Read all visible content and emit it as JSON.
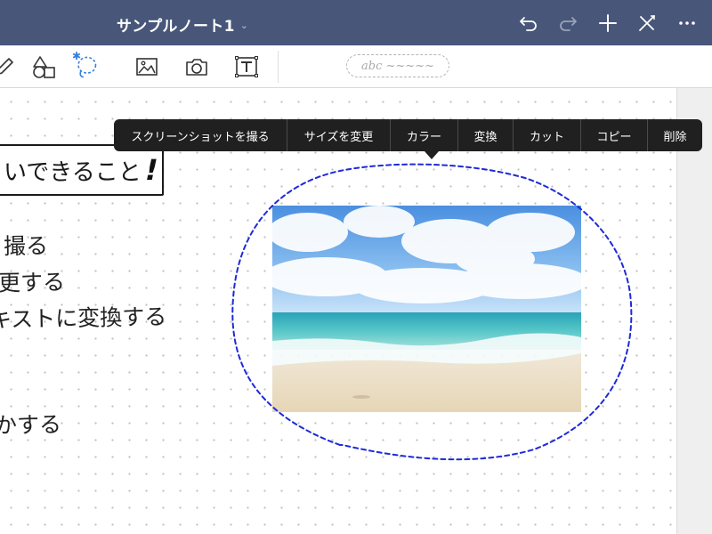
{
  "header": {
    "title": "サンプルノート1",
    "title_chevron": "⌄",
    "icons": [
      "undo-icon",
      "redo-icon",
      "add-icon",
      "close-edit-icon",
      "more-icon"
    ]
  },
  "toolbar": {
    "tools": [
      "pen-icon",
      "shape-icon",
      "lasso-icon",
      "image-icon",
      "camera-icon",
      "text-icon"
    ],
    "active_tool": "lasso-icon",
    "bluetooth_badge": "✱",
    "pen_preview": "abc ~~~~~"
  },
  "notes": {
    "heading": "いできること",
    "heading_mark": "!",
    "lines": [
      "撮る",
      "更する",
      "キストに変換する",
      "かする"
    ]
  },
  "context_menu": {
    "items": [
      "スクリーンショットを撮る",
      "サイズを変更",
      "カラー",
      "変換",
      "カット",
      "コピー",
      "削除"
    ]
  },
  "colors": {
    "titlebar": "#485679",
    "lasso": "#1f2ad8",
    "menu_bg": "#202020",
    "active_tool": "#3a7fd8"
  }
}
